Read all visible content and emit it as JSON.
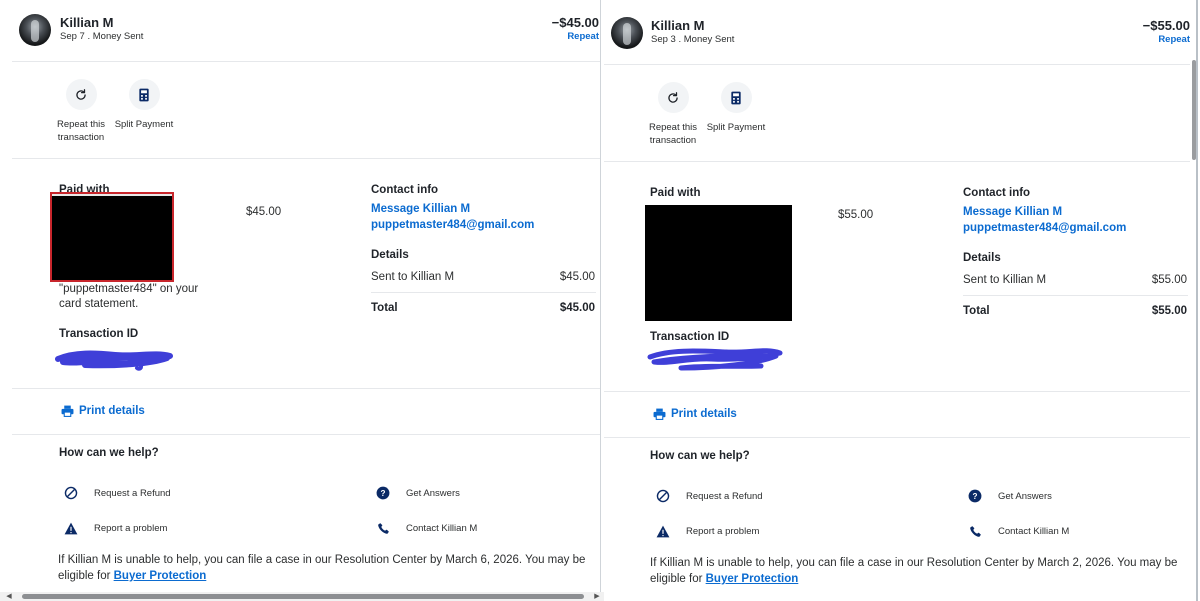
{
  "panels": [
    {
      "name": "Killian M",
      "sub": "Sep 7 . Money Sent",
      "amount": "−$45.00",
      "repeat": "Repeat",
      "actions": {
        "repeat_label": "Repeat this transaction",
        "split_label": "Split Payment"
      },
      "paid_with_label": "Paid with",
      "paid_amount": "$45.00",
      "statement_note": "\"puppetmaster484\" on your card statement.",
      "transaction_id_label": "Transaction ID",
      "contact": {
        "heading": "Contact info",
        "message_link": "Message Killian M",
        "email": "puppetmaster484@gmail.com"
      },
      "details": {
        "heading": "Details",
        "sent_to_label": "Sent to Killian M",
        "sent_to_value": "$45.00",
        "total_label": "Total",
        "total_value": "$45.00"
      },
      "print_label": "Print details",
      "help": {
        "heading": "How can we help?",
        "refund": "Request a Refund",
        "answers": "Get Answers",
        "report": "Report a problem",
        "contact": "Contact Killian M"
      },
      "footer_text": "If Killian M is unable to help, you can file a case in our Resolution Center by March 6, 2026. You may be eligible for ",
      "footer_link": "Buyer Protection"
    },
    {
      "name": "Killian M",
      "sub": "Sep 3 . Money Sent",
      "amount": "−$55.00",
      "repeat": "Repeat",
      "actions": {
        "repeat_label": "Repeat this transaction",
        "split_label": "Split Payment"
      },
      "paid_with_label": "Paid with",
      "paid_amount": "$55.00",
      "statement_note": "",
      "transaction_id_label": "Transaction ID",
      "contact": {
        "heading": "Contact info",
        "message_link": "Message Killian M",
        "email": "puppetmaster484@gmail.com"
      },
      "details": {
        "heading": "Details",
        "sent_to_label": "Sent to Killian M",
        "sent_to_value": "$55.00",
        "total_label": "Total",
        "total_value": "$55.00"
      },
      "print_label": "Print details",
      "help": {
        "heading": "How can we help?",
        "refund": "Request a Refund",
        "answers": "Get Answers",
        "report": "Report a problem",
        "contact": "Contact Killian M"
      },
      "footer_text": "If Killian M is unable to help, you can file a case in our Resolution Center by March 2, 2026. You may be eligible for ",
      "footer_link": "Buyer Protection"
    }
  ],
  "colors": {
    "link": "#0b6bd0",
    "icon_navy": "#0b2a66",
    "redact_frame": "#c8262c",
    "scribble": "#3f3fd8"
  },
  "icons": [
    "refresh-icon",
    "calculator-icon",
    "printer-icon",
    "blocked-icon",
    "question-icon",
    "warning-icon",
    "phone-icon"
  ]
}
